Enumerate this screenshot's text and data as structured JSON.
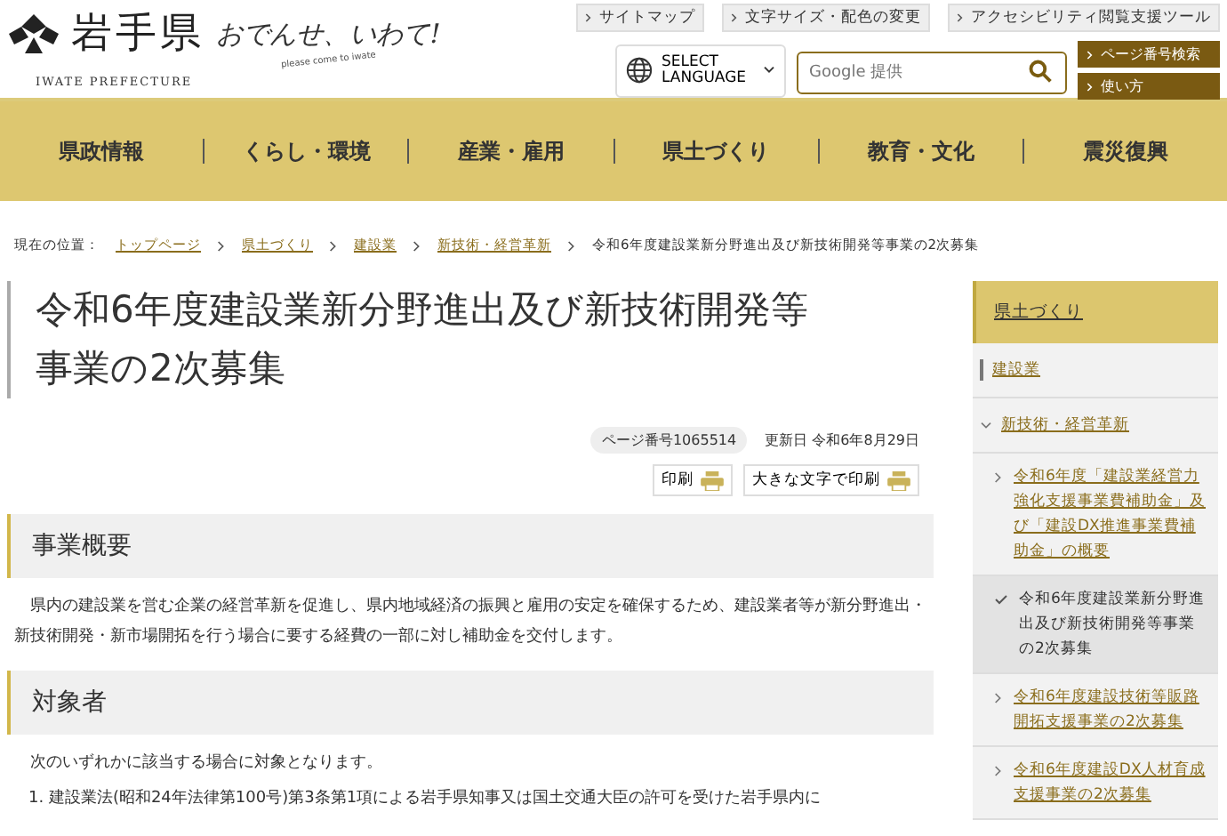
{
  "header": {
    "logo_text": "岩手県",
    "logo_sub": "IWATE PREFECTURE",
    "slogan": "おでんせ、いわて!",
    "slogan_sub": "please come to iwate",
    "top_links": [
      "サイトマップ",
      "文字サイズ・配色の変更",
      "アクセシビリティ閲覧支援ツール"
    ],
    "language": "SELECT LANGUAGE",
    "search": {
      "placeholder": "Google 提供"
    },
    "side_buttons": [
      "ページ番号検索",
      "使い方"
    ]
  },
  "nav": [
    "県政情報",
    "くらし・環境",
    "産業・雇用",
    "県土づくり",
    "教育・文化",
    "震災復興"
  ],
  "breadcrumb": {
    "label": "現在の位置：",
    "links": [
      "トップページ",
      "県土づくり",
      "建設業",
      "新技術・経営革新"
    ],
    "current": "令和6年度建設業新分野進出及び新技術開発等事業の2次募集"
  },
  "title": "令和6年度建設業新分野進出及び新技術開発等事業の2次募集",
  "page_number": "ページ番号1065514",
  "updated": "更新日 令和6年8月29日",
  "print_buttons": [
    "印刷",
    "大きな文字で印刷"
  ],
  "sections": [
    {
      "heading": "事業概要",
      "text": "県内の建設業を営む企業の経営革新を促進し、県内地域経済の振興と雇用の安定を確保するため、建設業者等が新分野進出・新技術開発・新市場開拓を行う場合に要する経費の一部に対し補助金を交付します。"
    },
    {
      "heading": "対象者",
      "text": "次のいずれかに該当する場合に対象となります。",
      "list": [
        "1.  建設業法(昭和24年法律第100号)第3条第1項による岩手県知事又は国土交通大臣の許可を受けた岩手県内に"
      ]
    }
  ],
  "sidebar": {
    "title": "県土づくり",
    "items": [
      {
        "label": "建設業",
        "expanded": false
      },
      {
        "label": "新技術・経営革新",
        "expanded": true,
        "children": [
          {
            "label": "令和6年度「建設業経営力強化支援事業費補助金」及び「建設DX推進事業費補助金」の概要",
            "selected": false
          },
          {
            "label": "令和6年度建設業新分野進出及び新技術開発等事業の2次募集",
            "selected": true
          },
          {
            "label": "令和6年度建設技術等販路開拓支援事業の2次募集",
            "selected": false
          },
          {
            "label": "令和6年度建設DX人材育成支援事業の2次募集",
            "selected": false
          }
        ]
      }
    ]
  }
}
